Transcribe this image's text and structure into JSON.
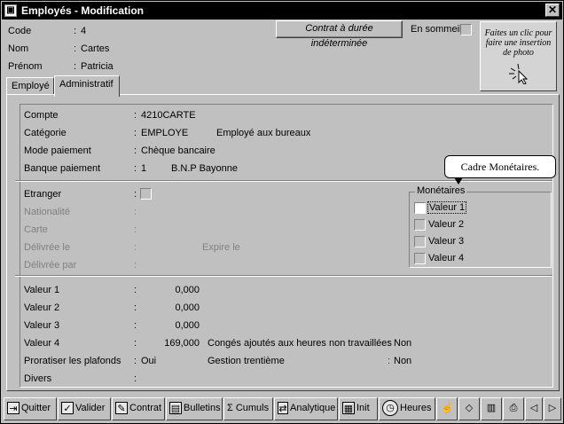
{
  "window": {
    "title": "Employés - Modification",
    "close": "✕"
  },
  "header": {
    "code_label": "Code",
    "code_value": "4",
    "nom_label": "Nom",
    "nom_value": "Cartes",
    "prenom_label": "Prénom",
    "prenom_value": "Patricia",
    "contract_button": "Contrat à durée indéterminée",
    "sommeil_label": "En sommeil",
    "photo_hint": "Faites un clic pour faire une insertion de photo"
  },
  "tabs": [
    {
      "label": "Employé",
      "active": false
    },
    {
      "label": "Administratif",
      "active": true
    }
  ],
  "admin": {
    "compte_label": "Compte",
    "compte_value": "4210CARTE",
    "categorie_label": "Catégorie",
    "categorie_code": "EMPLOYE",
    "categorie_desc": "Employé aux bureaux",
    "mode_label": "Mode paiement",
    "mode_value": "Chèque bancaire",
    "banque_label": "Banque paiement",
    "banque_code": "1",
    "banque_name": "B.N.P Bayonne",
    "etranger_label": "Etranger",
    "nationalite_label": "Nationalité",
    "carte_label": "Carte",
    "delivree_le_label": "Délivrée le",
    "expire_label": "Expire le",
    "delivree_par_label": "Délivrée par",
    "colon": ":"
  },
  "tooltip": "Cadre Monétaires.",
  "monetaires": {
    "legend": "Monétaires",
    "items": [
      "Valeur 1",
      "Valeur 2",
      "Valeur 3",
      "Valeur 4"
    ]
  },
  "valeurs": {
    "v1_label": "Valeur 1",
    "v1_value": "0,000",
    "v2_label": "Valeur 2",
    "v2_value": "0,000",
    "v3_label": "Valeur 3",
    "v3_value": "0,000",
    "v4_label": "Valeur 4",
    "v4_value": "169,000",
    "conges_label": "Congés ajoutés aux heures non travaillées",
    "conges_value": "Non",
    "proratiser_label": "Proratiser les plafonds",
    "proratiser_value": "Oui",
    "gestion_label": "Gestion trentième",
    "gestion_value": "Non",
    "divers_label": "Divers"
  },
  "toolbar": {
    "quitter": "Quitter",
    "valider": "Valider",
    "contrat": "Contrat",
    "bulletins": "Bulletins",
    "cumuls": "Cumuls",
    "analytique": "Analytique",
    "init": "Init",
    "heures": "Heures"
  }
}
